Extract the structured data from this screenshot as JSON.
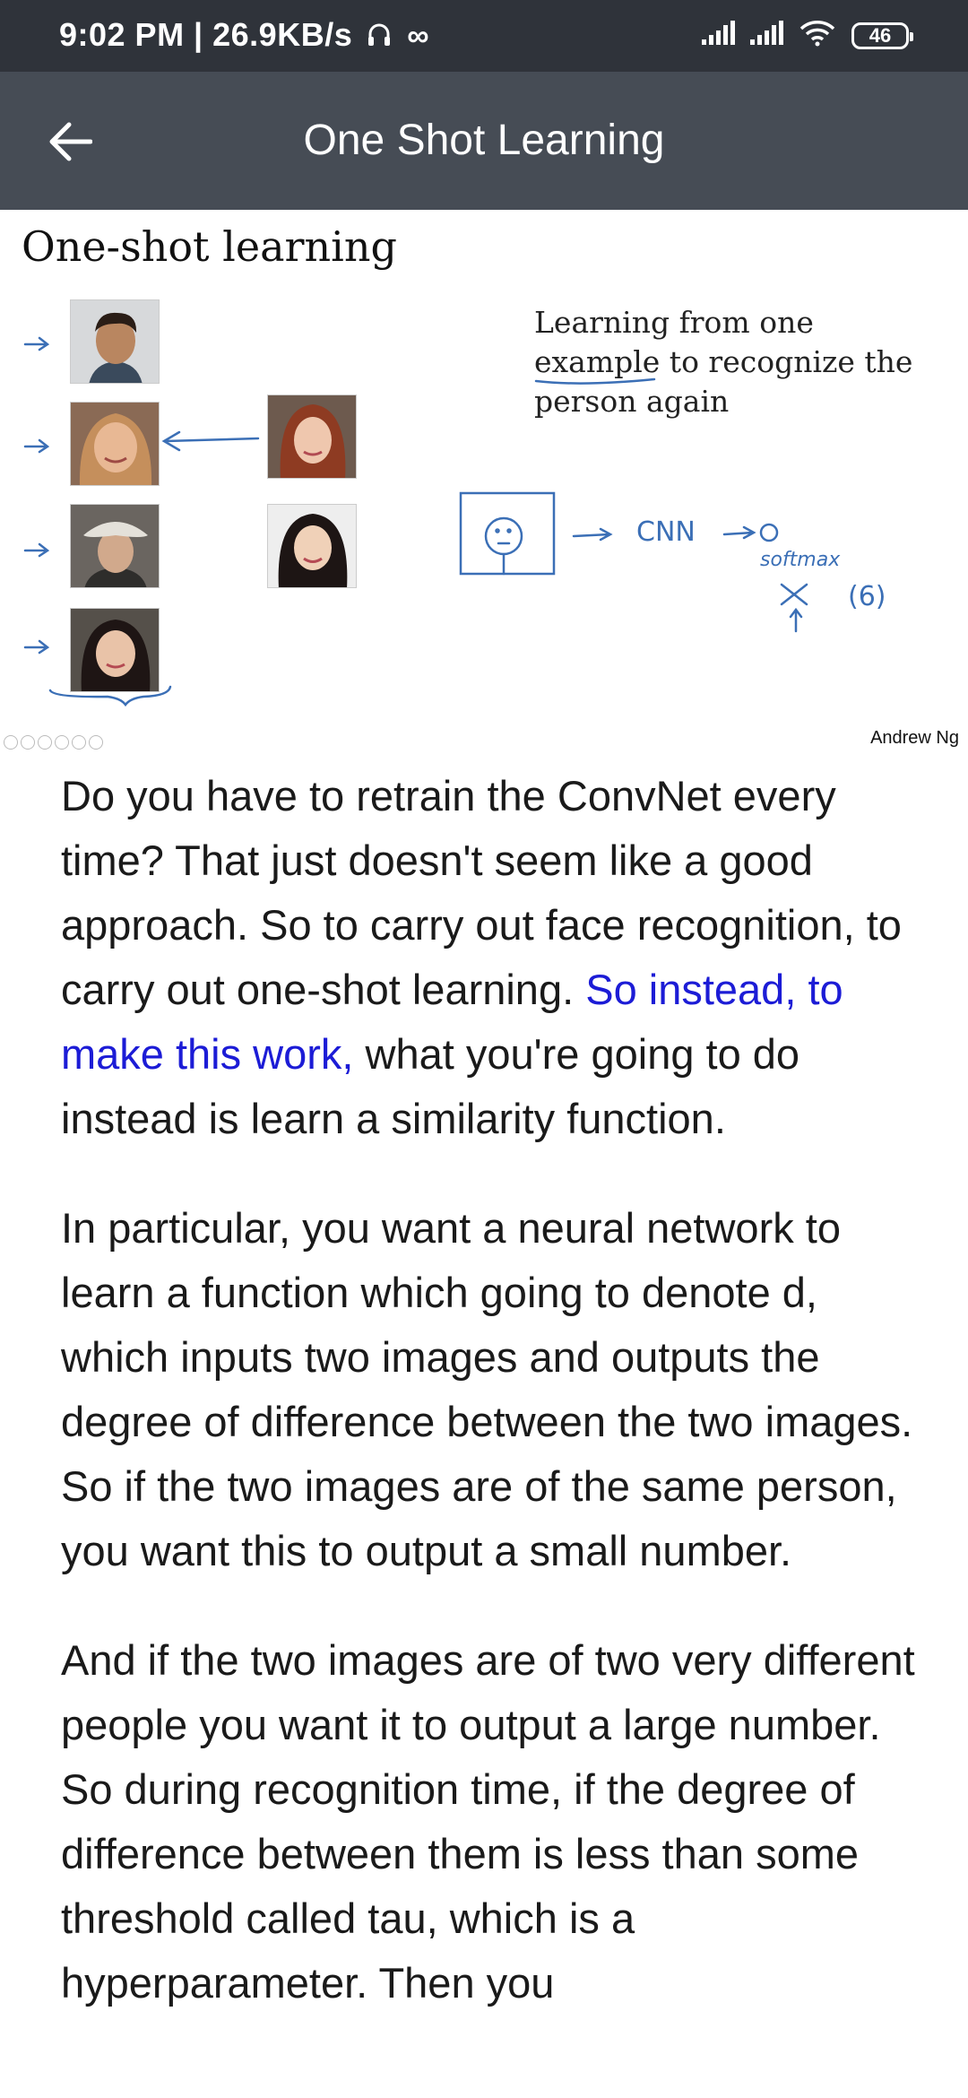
{
  "status_bar": {
    "time_speed": "9:02 PM | 26.9KB/s",
    "infinity": "∞",
    "battery": "46"
  },
  "app_bar": {
    "title": "One Shot Learning"
  },
  "slide": {
    "title": "One-shot learning",
    "description": "Learning from one example to recognize the person again",
    "cnn_label": "CNN",
    "softmax_label": "softmax",
    "count_label": "(6)",
    "credit": "Andrew Ng"
  },
  "article": {
    "p1_a": "Do you have to retrain the ConvNet every time? That just doesn't seem like a good approach. So to carry out face recognition, to carry out one-shot learning. ",
    "p1_highlight": "So instead, to make this work,",
    "p1_b": " what you're going to do instead is learn a similarity function.",
    "p2": "In particular, you want a neural network to learn a function which going to denote d, which inputs two images and outputs the degree of difference between the two images. So if the two images are of the same person, you want this to output a small number.",
    "p3": "And if the two images are of two very different people you want it to output a large number. So during recognition time, if the degree of difference between them is less than some threshold called tau, which is a hyperparameter. Then you"
  },
  "colors": {
    "status_bar_bg": "#2f333a",
    "app_bar_bg": "#464c55",
    "highlight_text": "#1c1cd6",
    "handwriting": "#3b6fb6"
  },
  "icons": [
    "back-arrow-icon",
    "headphones-icon",
    "signal-icon",
    "wifi-icon",
    "battery-icon"
  ]
}
